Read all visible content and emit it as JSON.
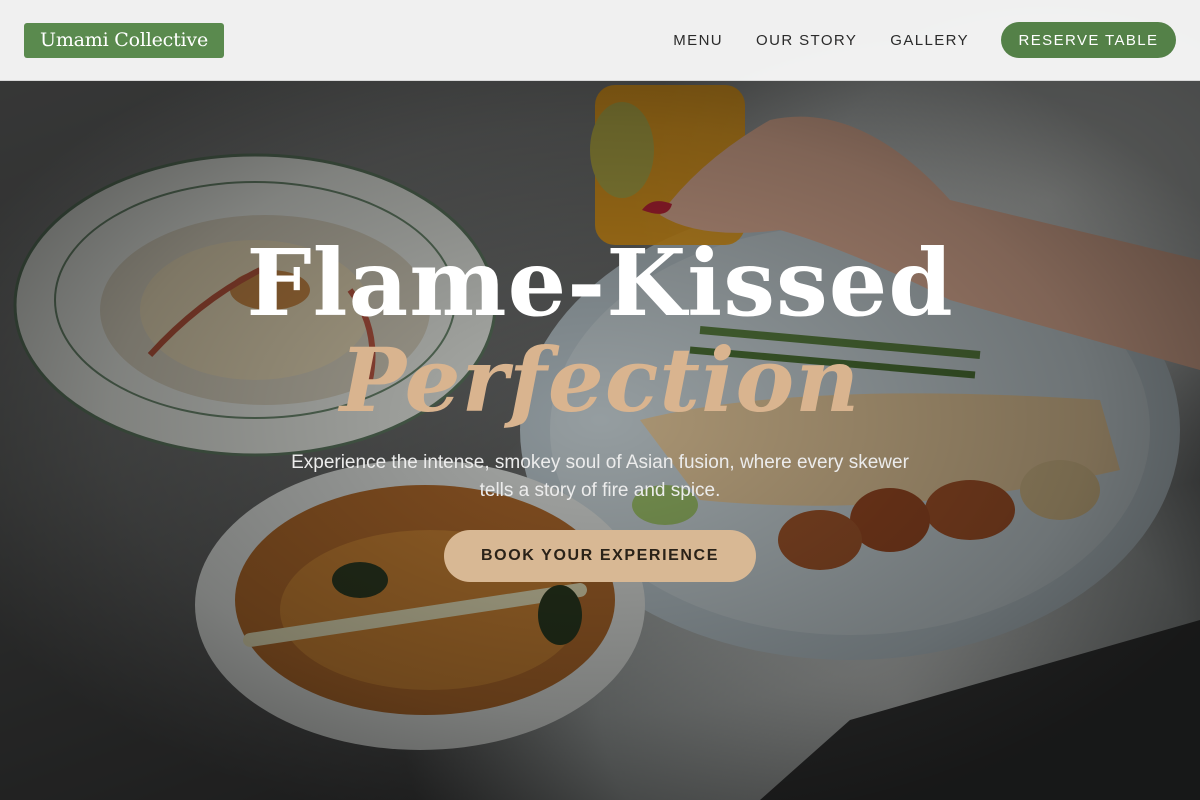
{
  "brand": {
    "name": "Umami Collective",
    "color": "#5a8a4e"
  },
  "nav": {
    "items": [
      {
        "label": "MENU"
      },
      {
        "label": "OUR STORY"
      },
      {
        "label": "GALLERY"
      }
    ],
    "reserve_label": "RESERVE TABLE",
    "reserve_color": "#548148"
  },
  "hero": {
    "title_line_1": "Flame-Kissed",
    "title_line_2": "Perfection",
    "subtitle": "Experience the intense, smokey soul of Asian fusion, where every skewer tells a story of fire and spice.",
    "cta_label": "BOOK YOUR EXPERIENCE",
    "accent_color": "#d9b48f"
  }
}
